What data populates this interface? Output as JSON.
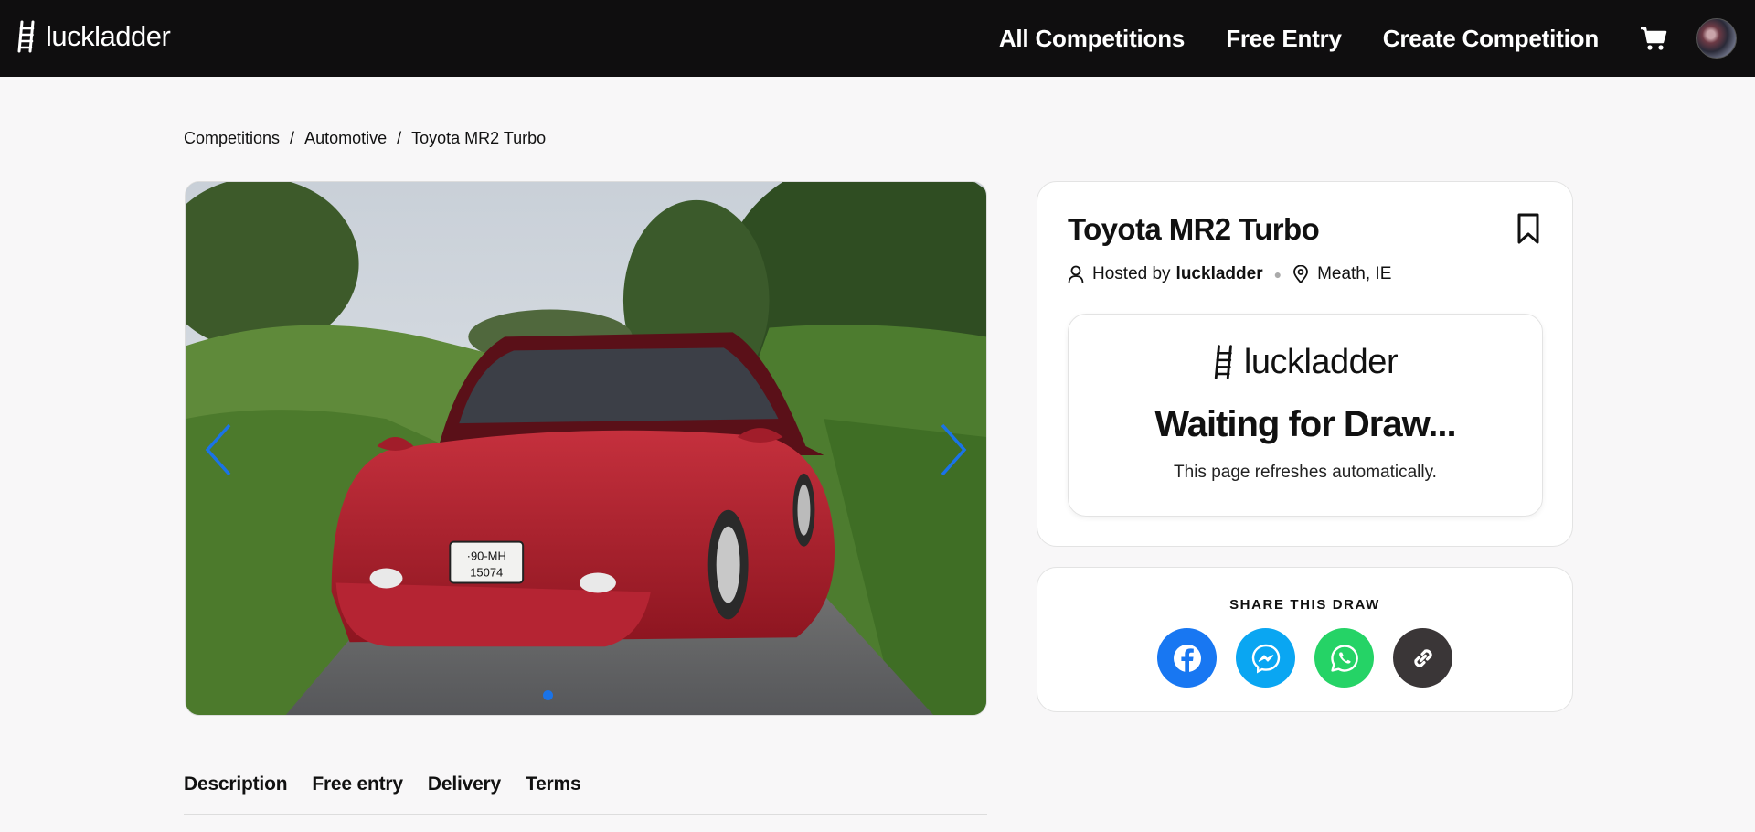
{
  "header": {
    "logo_text": "luckladder",
    "nav": [
      "All Competitions",
      "Free Entry",
      "Create Competition"
    ],
    "icons": {
      "cart": "cart-icon",
      "avatar": "user-avatar"
    }
  },
  "breadcrumb": [
    "Competitions",
    "Automotive",
    "Toyota MR2 Turbo"
  ],
  "breadcrumb_separator": "/",
  "gallery": {
    "image": "red Toyota MR2 Turbo on country lane",
    "slides": 1,
    "active_slide": 1
  },
  "competition": {
    "title": "Toyota MR2 Turbo",
    "hosted_prefix": "Hosted by",
    "host": "luckladder",
    "location": "Meath, IE",
    "draw_logo_text": "luckladder",
    "status": "Waiting for Draw...",
    "note": "This page refreshes automatically."
  },
  "share": {
    "title": "SHARE THIS DRAW",
    "buttons": [
      {
        "name": "facebook",
        "color": "#1877f2"
      },
      {
        "name": "messenger",
        "color": "#0aa6f2"
      },
      {
        "name": "whatsapp",
        "color": "#25d366"
      },
      {
        "name": "copy-link",
        "color": "#3a3637"
      }
    ]
  },
  "tabs": [
    "Description",
    "Free entry",
    "Delivery",
    "Terms"
  ],
  "colors": {
    "header_bg": "#0f0e0f",
    "accent": "#1a73e8",
    "background": "#f8f7f8"
  }
}
